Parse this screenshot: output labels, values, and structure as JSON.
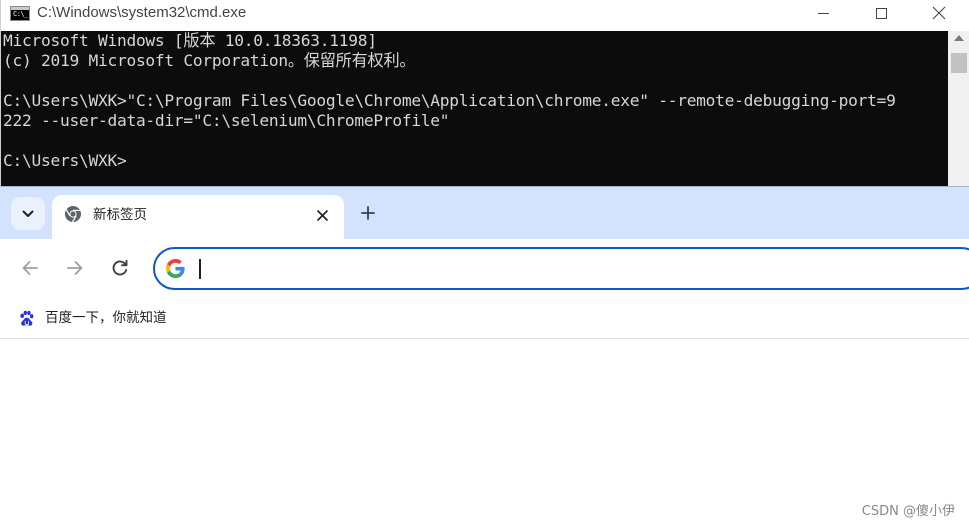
{
  "cmd": {
    "title": "C:\\Windows\\system32\\cmd.exe",
    "icon_text": "C:\\_",
    "lines": [
      "Microsoft Windows [版本 10.0.18363.1198]",
      "(c) 2019 Microsoft Corporation。保留所有权利。",
      "",
      "C:\\Users\\WXK>\"C:\\Program Files\\Google\\Chrome\\Application\\chrome.exe\" --remote-debugging-port=9",
      "222 --user-data-dir=\"C:\\selenium\\ChromeProfile\"",
      "",
      "C:\\Users\\WXK>"
    ]
  },
  "chrome": {
    "tab": {
      "title": "新标签页"
    },
    "omnibox": {
      "value": "",
      "placeholder": ""
    },
    "bookmarks": [
      {
        "label": "百度一下，你就知道",
        "icon": "baidu-paw-icon"
      }
    ],
    "colors": {
      "tab_strip": "#d3e3fd",
      "omnibox_border": "#0b57d0",
      "console_bg": "#0c0c0c"
    }
  },
  "watermark": "CSDN @傻小伊"
}
